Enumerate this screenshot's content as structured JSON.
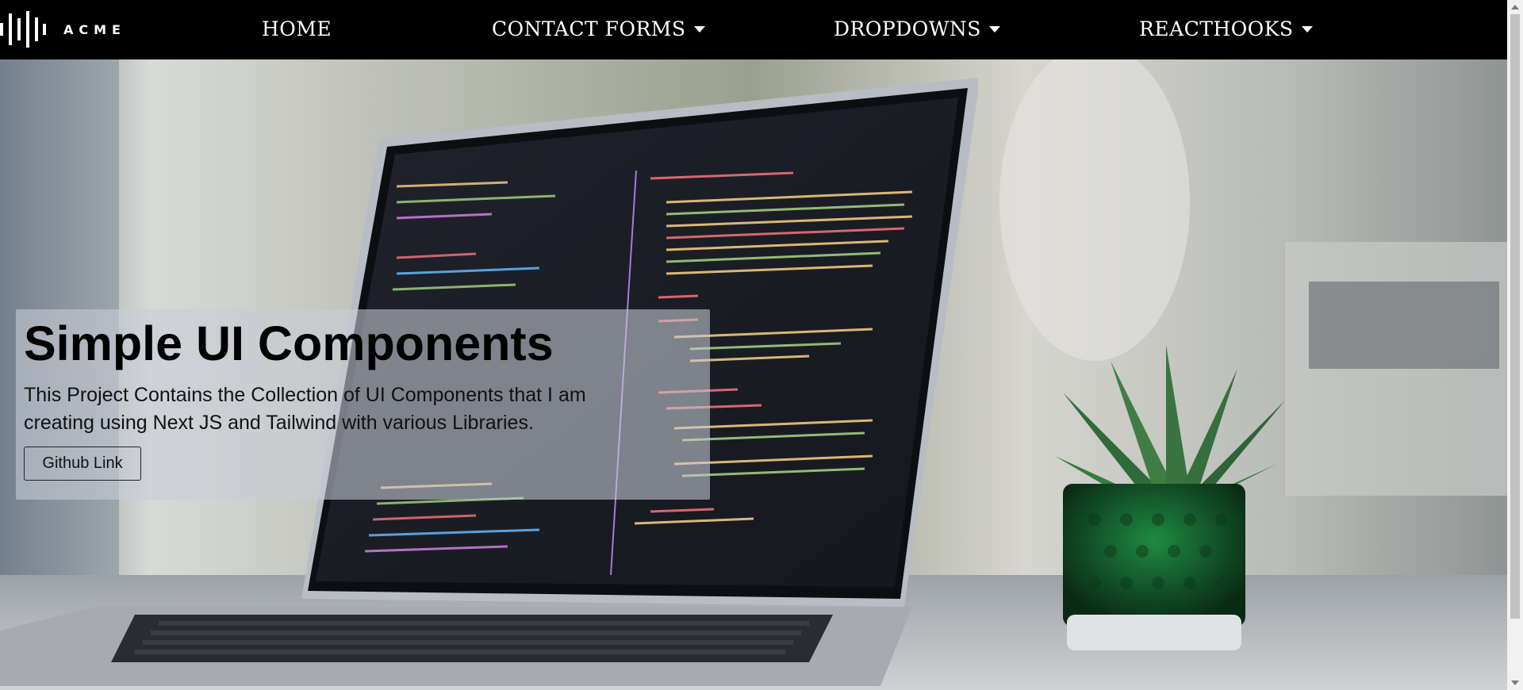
{
  "navbar": {
    "logo_text": "ACME",
    "logo_icon": "waveform-icon",
    "items": [
      {
        "label": "HOME",
        "has_dropdown": false
      },
      {
        "label": "CONTACT FORMS",
        "has_dropdown": true
      },
      {
        "label": "DROPDOWNS",
        "has_dropdown": true
      },
      {
        "label": "REACTHOOKS",
        "has_dropdown": true
      }
    ]
  },
  "hero": {
    "title": "Simple UI Components",
    "description": "This Project Contains the Collection of UI Components that I am creating using Next JS and Tailwind with various Libraries.",
    "button_label": "Github Link",
    "background_image": "laptop-with-code-and-plant-photo"
  },
  "colors": {
    "navbar_bg": "#000000",
    "navbar_text": "#ffffff",
    "card_bg": "rgba(200,205,215,0.58)",
    "text": "#000000"
  }
}
